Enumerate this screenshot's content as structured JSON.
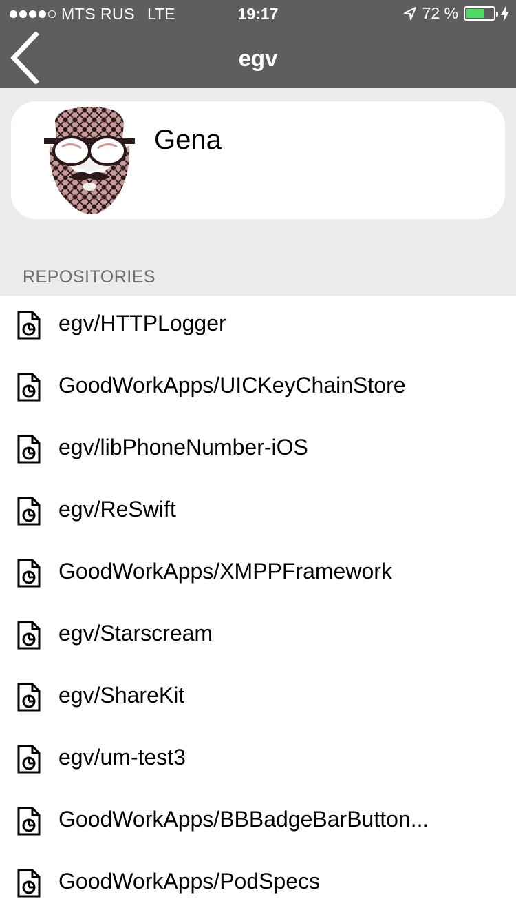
{
  "status_bar": {
    "carrier": "MTS RUS",
    "network": "LTE",
    "time": "19:17",
    "battery_percent": "72 %",
    "battery_level": 0.72,
    "signal_bars": 4
  },
  "nav": {
    "title": "egv",
    "back_icon": "chevron-left-icon"
  },
  "profile": {
    "name": "Gena",
    "avatar_icon": "bearded-face-avatar"
  },
  "repositories": {
    "header": "REPOSITORIES",
    "items": [
      {
        "name": "egv/HTTPLogger"
      },
      {
        "name": "GoodWorkApps/UICKeyChainStore"
      },
      {
        "name": "egv/libPhoneNumber-iOS"
      },
      {
        "name": "egv/ReSwift"
      },
      {
        "name": "GoodWorkApps/XMPPFramework"
      },
      {
        "name": "egv/Starscream"
      },
      {
        "name": "egv/ShareKit"
      },
      {
        "name": "egv/um-test3"
      },
      {
        "name": "GoodWorkApps/BBBadgeBarButton..."
      },
      {
        "name": "GoodWorkApps/PodSpecs"
      }
    ],
    "item_icon": "repo-file-icon"
  },
  "colors": {
    "bar_background": "#5e5e5e",
    "page_background": "#ebebeb",
    "battery_green": "#4cd964"
  }
}
